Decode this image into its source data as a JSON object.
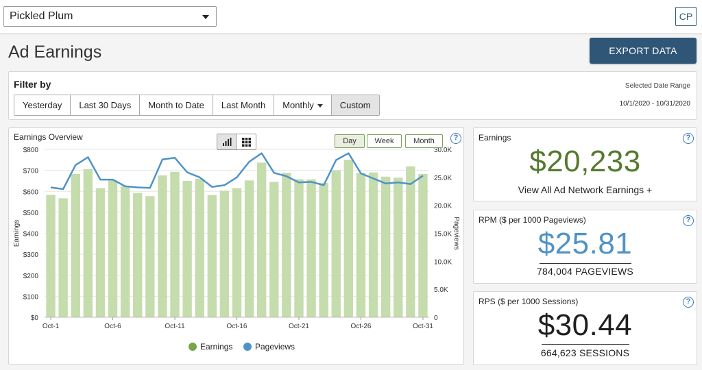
{
  "header": {
    "site_name": "Pickled Plum",
    "user_initials": "CP"
  },
  "page": {
    "title": "Ad Earnings",
    "export_label": "EXPORT DATA"
  },
  "filter": {
    "title": "Filter by",
    "buttons": [
      {
        "label": "Yesterday",
        "active": false,
        "dropdown": false
      },
      {
        "label": "Last 30 Days",
        "active": false,
        "dropdown": false
      },
      {
        "label": "Month to Date",
        "active": false,
        "dropdown": false
      },
      {
        "label": "Last Month",
        "active": false,
        "dropdown": false
      },
      {
        "label": "Monthly",
        "active": false,
        "dropdown": true
      },
      {
        "label": "Custom",
        "active": true,
        "dropdown": false
      }
    ],
    "date_range_label": "Selected Date Range",
    "date_range": "10/1/2020 - 10/31/2020"
  },
  "overview": {
    "title": "Earnings Overview",
    "period_buttons": [
      {
        "label": "Day",
        "active": true
      },
      {
        "label": "Week",
        "active": false
      },
      {
        "label": "Month",
        "active": false
      }
    ],
    "help": "?"
  },
  "chart_data": {
    "type": "bar",
    "categories": [
      "Oct-1",
      "Oct-2",
      "Oct-3",
      "Oct-4",
      "Oct-5",
      "Oct-6",
      "Oct-7",
      "Oct-8",
      "Oct-9",
      "Oct-10",
      "Oct-11",
      "Oct-12",
      "Oct-13",
      "Oct-14",
      "Oct-15",
      "Oct-16",
      "Oct-17",
      "Oct-18",
      "Oct-19",
      "Oct-20",
      "Oct-21",
      "Oct-22",
      "Oct-23",
      "Oct-24",
      "Oct-25",
      "Oct-26",
      "Oct-27",
      "Oct-28",
      "Oct-29",
      "Oct-30",
      "Oct-31"
    ],
    "x_tick_labels": [
      "Oct-1",
      "Oct-6",
      "Oct-11",
      "Oct-16",
      "Oct-21",
      "Oct-26",
      "Oct-31"
    ],
    "series": [
      {
        "name": "Earnings",
        "axis": "left",
        "kind": "bar",
        "color": "#c5dcad",
        "values": [
          583,
          567,
          683,
          706,
          615,
          652,
          624,
          592,
          577,
          676,
          693,
          650,
          660,
          582,
          603,
          615,
          652,
          737,
          645,
          688,
          658,
          657,
          640,
          700,
          750,
          688,
          690,
          670,
          665,
          719,
          683
        ]
      },
      {
        "name": "Pageviews",
        "axis": "right",
        "kind": "line",
        "color": "#4f93c6",
        "values": [
          23200,
          22900,
          27200,
          28600,
          24600,
          24600,
          23400,
          23200,
          23100,
          28200,
          28500,
          25900,
          25000,
          23300,
          23600,
          25000,
          27800,
          29300,
          25800,
          25200,
          24100,
          24200,
          23600,
          28100,
          29300,
          25700,
          24800,
          23900,
          24100,
          23800,
          25300
        ]
      }
    ],
    "y_left": {
      "label": "Earnings",
      "min": 0,
      "max": 800,
      "ticks": [
        "$0",
        "$100",
        "$200",
        "$300",
        "$400",
        "$500",
        "$600",
        "$700",
        "$800"
      ]
    },
    "y_right": {
      "label": "Pageviews",
      "min": 0,
      "max": 30000,
      "ticks": [
        "0",
        "5.0K",
        "10.0K",
        "15.0K",
        "20.0K",
        "25.0K",
        "30.0K"
      ]
    },
    "grid": true,
    "legend_placement": "bottom-center",
    "legend": [
      {
        "name": "Earnings",
        "color": "#75a64b"
      },
      {
        "name": "Pageviews",
        "color": "#4f93c6"
      }
    ]
  },
  "earnings": {
    "label": "Earnings",
    "value": "$20,233",
    "link": "View All Ad Network Earnings +",
    "color": "#557a2e",
    "help": "?"
  },
  "rpm": {
    "label": "RPM ($ per 1000 Pageviews)",
    "value": "$25.81",
    "sub": "784,004 PAGEVIEWS",
    "color": "#4f93c6",
    "help": "?"
  },
  "rps": {
    "label": "RPS ($ per 1000 Sessions)",
    "value": "$30.44",
    "sub": "664,623 SESSIONS",
    "color": "#1f1f1f",
    "help": "?"
  },
  "colors": {
    "accent": "#2f5677",
    "help": "#3a7cc0",
    "period_border": "#7da05b"
  }
}
